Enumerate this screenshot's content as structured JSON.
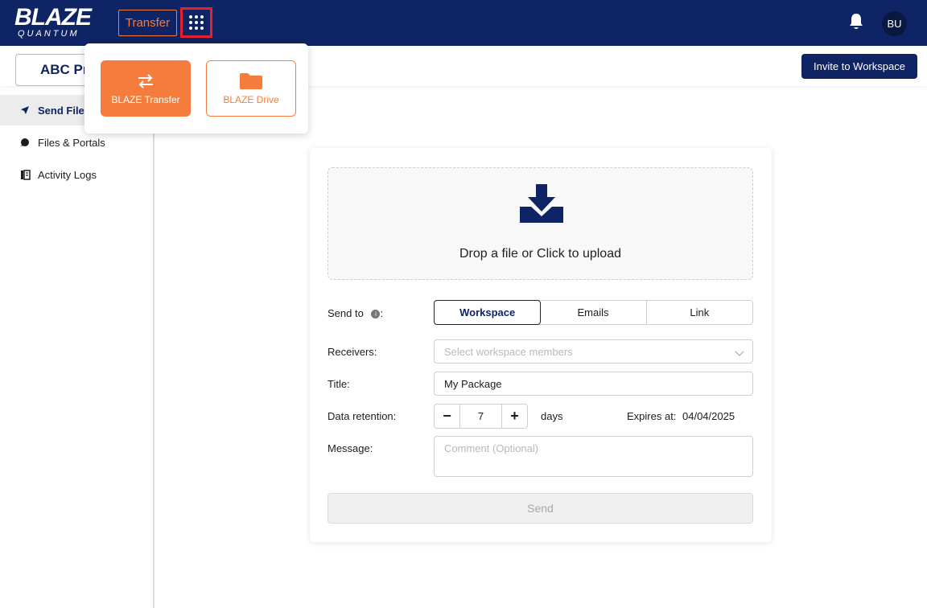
{
  "header": {
    "logo_main": "BLAZE",
    "logo_sub": "QUANTUM",
    "transfer_label": "Transfer",
    "apps_icon": "grid-dots-icon",
    "bell_icon": "bell-icon",
    "avatar_initials": "BU"
  },
  "subbar": {
    "workspace_label": "ABC Pr",
    "invite_label": "Invite to Workspace"
  },
  "sidebar": {
    "items": [
      {
        "label": "Send Files",
        "icon": "send-icon",
        "active": true
      },
      {
        "label": "Files & Portals",
        "icon": "chat-bubble-icon",
        "active": false
      },
      {
        "label": "Activity Logs",
        "icon": "logs-icon",
        "active": false
      }
    ]
  },
  "app_switcher": {
    "apps": [
      {
        "label": "BLAZE Transfer",
        "icon": "swap-arrows-icon"
      },
      {
        "label": "BLAZE Drive",
        "icon": "folder-icon"
      }
    ]
  },
  "upload": {
    "dropzone_text": "Drop a file or Click to upload",
    "icon": "download-tray-icon"
  },
  "form": {
    "send_to_label": "Send to",
    "send_to_tabs": [
      "Workspace",
      "Emails",
      "Link"
    ],
    "send_to_selected": "Workspace",
    "receivers_label": "Receivers:",
    "receivers_placeholder": "Select workspace members",
    "title_label": "Title:",
    "title_value": "My Package",
    "retention_label": "Data retention:",
    "retention_value": "7",
    "retention_minus": "−",
    "retention_plus": "+",
    "days_label": "days",
    "expires_label": "Expires at:",
    "expires_value": "04/04/2025",
    "message_label": "Message:",
    "message_placeholder": "Comment (Optional)",
    "send_label": "Send"
  },
  "colors": {
    "navy": "#0f2464",
    "orange": "#f47c3c",
    "highlight_red": "#e5202e"
  }
}
